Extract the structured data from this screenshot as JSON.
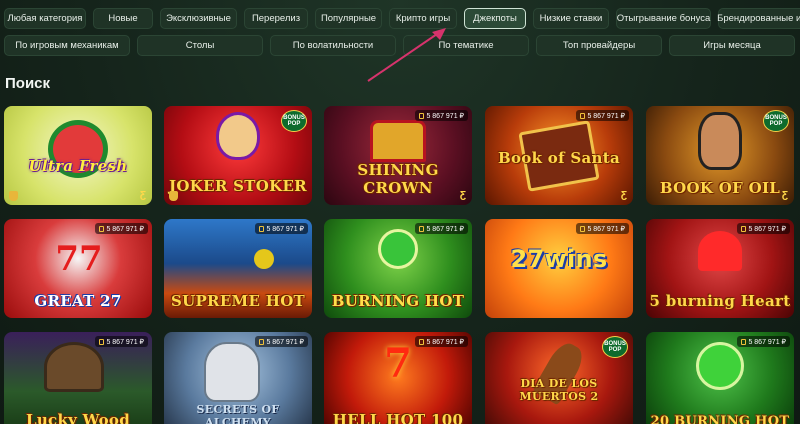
{
  "filters": {
    "row1": [
      "Любая категория",
      "Новые",
      "Эксклюзивные",
      "Перерелиз",
      "Популярные",
      "Крипто игры",
      "Джекпоты",
      "Низкие ставки",
      "Отыгрывание бонуса",
      "Брендированные игры"
    ],
    "row1_active_index": 6,
    "row2": [
      "По игровым механикам",
      "Столы",
      "По волатильности",
      "По тематике",
      "Топ провайдеры",
      "Игры месяца"
    ]
  },
  "section_title": "Поиск",
  "jackpot_amount": "5 867 971 ₽",
  "bonus_pop": "BONUS POP",
  "provider_mark": "Ƹ",
  "games": [
    {
      "title": "Ultra Fresh"
    },
    {
      "title": "JOKER STOKER"
    },
    {
      "title": "SHINING CROWN"
    },
    {
      "title": "Book of Santa"
    },
    {
      "title": "BOOK OF OIL"
    },
    {
      "title": "GREAT 27"
    },
    {
      "title": "SUPREME HOT"
    },
    {
      "title": "BURNING HOT"
    },
    {
      "title": "27wins"
    },
    {
      "title": "5 burning Heart"
    },
    {
      "title": "Lucky Wood"
    },
    {
      "title": "SECRETS OF ALCHEMY"
    },
    {
      "title": "HELL HOT 100"
    },
    {
      "title": "DIA DE LOS MUERTOS 2"
    },
    {
      "title": "20 BURNING HOT"
    }
  ],
  "colors": {
    "accent_arrow": "#d6336c",
    "active_chip_border": "#cfe3d5",
    "background": "#17271d"
  }
}
